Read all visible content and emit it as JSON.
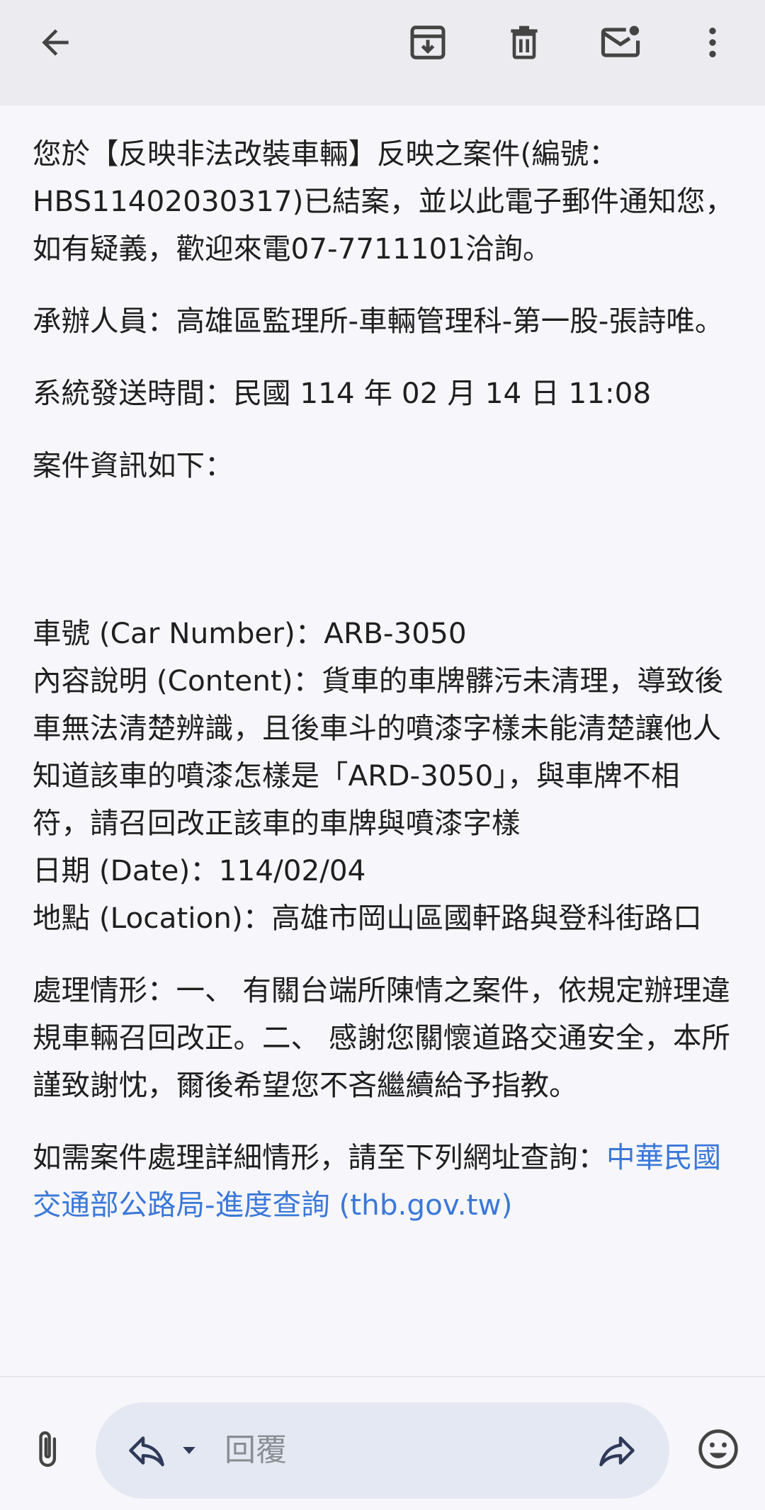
{
  "toolbar": {
    "icons": [
      "back-arrow-icon",
      "archive-icon",
      "delete-icon",
      "mark-unread-icon",
      "more-vert-icon"
    ]
  },
  "email": {
    "intro": "您於【反映非法改裝車輛】反映之案件(編號：HBS11402030317)已結案，並以此電子郵件通知您，如有疑義，歡迎來電07-7711101洽詢。",
    "handler": "承辦人員：高雄區監理所-車輛管理科-第一股-張詩唯。",
    "sent_time": "系統發送時間：民國 114 年 02 月 14 日 11:08",
    "info_heading": "案件資訊如下：",
    "car_number": "車號 (Car Number)：ARB-3050",
    "content": "內容說明 (Content)：貨車的車牌髒污未清理，導致後車無法清楚辨識，且後車斗的噴漆字樣未能清楚讓他人知道該車的噴漆怎樣是「ARD-3050」，與車牌不相符，請召回改正該車的車牌與噴漆字樣",
    "date": "日期 (Date)：114/02/04",
    "location": "地點 (Location)：高雄市岡山區國軒路與登科街路口",
    "handling": "處理情形：一、 有關台端所陳情之案件，依規定辦理違規車輛召回改正。二、 感謝您關懷道路交通安全，本所謹致謝忱，爾後希望您不吝繼續給予指教。",
    "query_prefix": "如需案件處理詳細情形，請至下列網址查詢：",
    "query_link": "中華民國交通部公路局-進度查詢 (thb.gov.tw)"
  },
  "bottom_bar": {
    "reply_placeholder": "回覆",
    "icons": [
      "attachment-icon",
      "reply-icon",
      "reply-options-chevron-icon",
      "forward-icon",
      "emoji-icon"
    ]
  },
  "colors": {
    "link": "#3b78d8",
    "toolbar_bg": "#ececf0",
    "reply_pill_bg": "#e4e8f2"
  }
}
